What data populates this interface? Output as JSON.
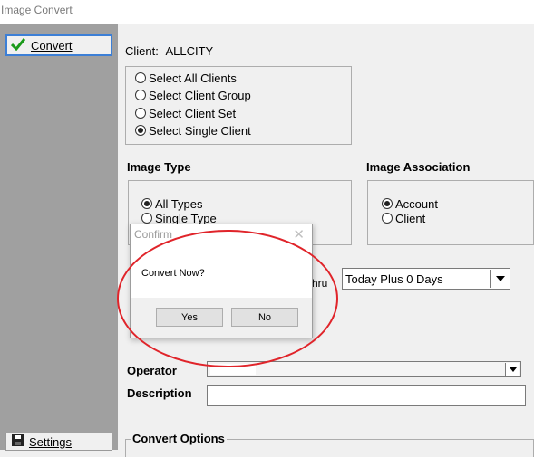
{
  "window": {
    "title": "Image Convert"
  },
  "sidebar": {
    "convert_label": "Convert",
    "settings_label": "Settings"
  },
  "client": {
    "label": "Client:",
    "value": "ALLCITY",
    "options": [
      "Select All Clients",
      "Select Client Group",
      "Select Client Set",
      "Select Single Client"
    ],
    "selected": "Select Single Client"
  },
  "image_type": {
    "label": "Image Type",
    "options": [
      "All Types",
      "Single Type"
    ],
    "selected": "All Types"
  },
  "image_association": {
    "label": "Image Association",
    "options": [
      "Account",
      "Client"
    ],
    "selected": "Account"
  },
  "date_range": {
    "thru_fragment": "hru",
    "value": "Today Plus 0 Days"
  },
  "operator": {
    "label": "Operator",
    "value": ""
  },
  "description": {
    "label": "Description",
    "value": ""
  },
  "convert_options": {
    "label": "Convert Options"
  },
  "dialog": {
    "title": "Confirm",
    "message": "Convert Now?",
    "yes_label": "Yes",
    "no_label": "No",
    "close_glyph": "✕"
  },
  "colors": {
    "sidebar_bg": "#a0a0a0",
    "highlight_ellipse": "#e0242a",
    "focus_border": "#3c7fd6",
    "check_green": "#1a9a1a"
  },
  "icons": {
    "convert": "checkmark-icon",
    "settings": "floppy-disk-icon"
  }
}
